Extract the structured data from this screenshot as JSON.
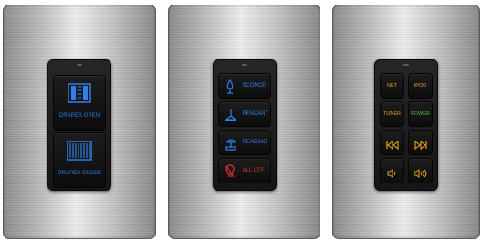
{
  "colors": {
    "blue": "#2f7fe8",
    "red": "#e0302a",
    "amber": "#e8a21c",
    "green": "#4ec633"
  },
  "panels": [
    {
      "name": "drapes",
      "buttons": [
        {
          "label": "DRAPES OPEN",
          "icon": "drapes-open-icon"
        },
        {
          "label": "DRAPES CLOSE",
          "icon": "drapes-close-icon"
        }
      ]
    },
    {
      "name": "lighting",
      "buttons": [
        {
          "label": "SCONCE",
          "icon": "sconce-icon"
        },
        {
          "label": "PENDANT",
          "icon": "pendant-icon"
        },
        {
          "label": "READING",
          "icon": "reading-lamp-icon"
        },
        {
          "label": "ALL OFF",
          "icon": "light-off-icon"
        }
      ]
    },
    {
      "name": "audio",
      "buttons": [
        {
          "label": "NET"
        },
        {
          "label": "IPOD"
        },
        {
          "label": "TUNER"
        },
        {
          "label": "POWER"
        },
        {
          "label": "",
          "icon": "skip-back-icon"
        },
        {
          "label": "",
          "icon": "skip-forward-icon"
        },
        {
          "label": "",
          "icon": "volume-down-icon"
        },
        {
          "label": "",
          "icon": "volume-up-icon"
        }
      ]
    }
  ]
}
